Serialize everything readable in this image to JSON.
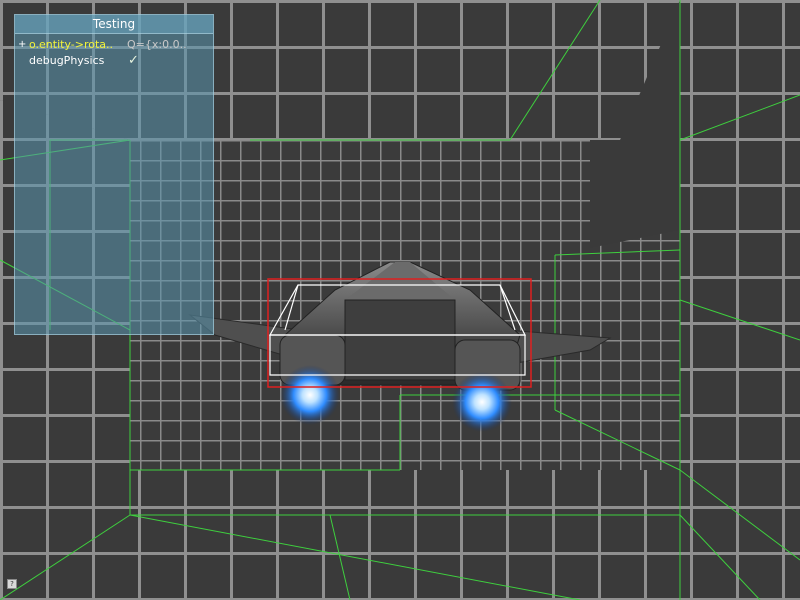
{
  "debug_panel": {
    "title": "Testing",
    "rows": [
      {
        "expander": "+",
        "key": "o.entity->rota..",
        "value": "Q={x:0.0.."
      },
      {
        "key": "debugPhysics",
        "value": "✓"
      }
    ]
  },
  "colors": {
    "grid_line": "#8c8c8c",
    "wall": "#3b3b3b",
    "physics_wire": "#3ecf3e",
    "bbox_red": "#e02020",
    "bbox_white": "#ffffff",
    "thruster_glow": "#2f8cff",
    "panel_key_highlight": "#f3f33a"
  },
  "corner_button": {
    "icon": "console-toggle-icon",
    "glyph": "?"
  }
}
